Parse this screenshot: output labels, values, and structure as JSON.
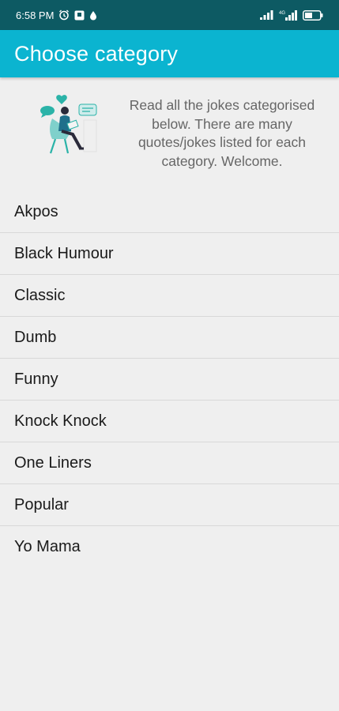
{
  "status_bar": {
    "time": "6:58 PM",
    "icons_left": [
      "alarm-icon",
      "notification-box-icon",
      "drop-icon"
    ],
    "icons_right": [
      "signal-icon",
      "4g-signal-icon",
      "battery-icon"
    ],
    "net_label": "4G"
  },
  "app_bar": {
    "title": "Choose category"
  },
  "intro": {
    "text": "Read all the jokes categorised below. There are many quotes/jokes listed for each category. Welcome."
  },
  "categories": [
    {
      "label": "Akpos"
    },
    {
      "label": "Black Humour"
    },
    {
      "label": "Classic"
    },
    {
      "label": "Dumb"
    },
    {
      "label": "Funny"
    },
    {
      "label": "Knock Knock"
    },
    {
      "label": "One Liners"
    },
    {
      "label": "Popular"
    },
    {
      "label": "Yo Mama"
    }
  ],
  "colors": {
    "status_bar": "#0d5a63",
    "app_bar": "#0bb4d0",
    "background": "#efefef",
    "accent": "#2bb3a8"
  }
}
